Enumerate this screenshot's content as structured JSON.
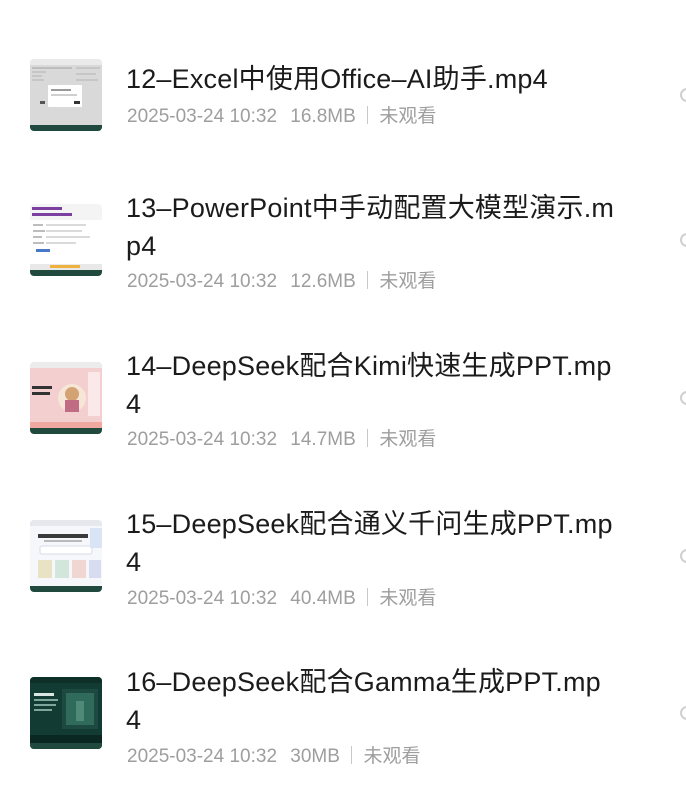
{
  "videos": [
    {
      "title": "12–Excel中使用Office–AI助手.mp4",
      "date": "2025-03-24 10:32",
      "size": "16.8MB",
      "status": "未观看",
      "thumb": "excel-window-thumbnail"
    },
    {
      "title": "13–PowerPoint中手动配置大模型演示.mp4",
      "date": "2025-03-24 10:32",
      "size": "12.6MB",
      "status": "未观看",
      "thumb": "powerpoint-window-thumbnail"
    },
    {
      "title": "14–DeepSeek配合Kimi快速生成PPT.mp4",
      "date": "2025-03-24 10:32",
      "size": "14.7MB",
      "status": "未观看",
      "thumb": "kimi-slide-thumbnail"
    },
    {
      "title": "15–DeepSeek配合通义千问生成PPT.mp4",
      "date": "2025-03-24 10:32",
      "size": "40.4MB",
      "status": "未观看",
      "thumb": "tongyi-page-thumbnail"
    },
    {
      "title": "16–DeepSeek配合Gamma生成PPT.mp4",
      "date": "2025-03-24 10:32",
      "size": "30MB",
      "status": "未观看",
      "thumb": "gamma-dark-thumbnail"
    }
  ]
}
